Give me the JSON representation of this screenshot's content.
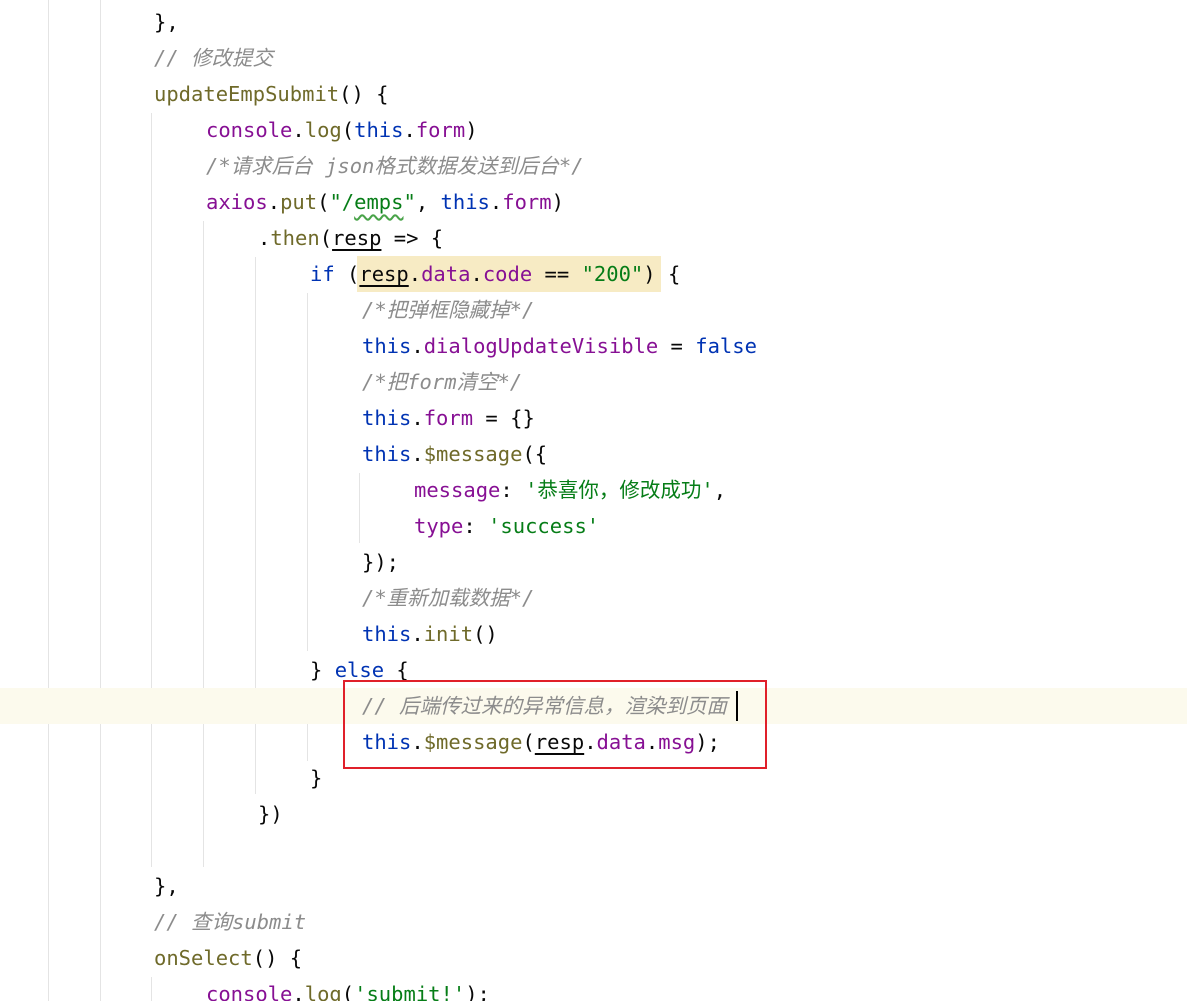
{
  "editor": {
    "lines": [
      [
        {
          "t": "},",
          "c": "plain"
        }
      ],
      [
        {
          "t": "// 修改提交",
          "c": "comment"
        }
      ],
      [
        {
          "t": "updateEmpSubmit",
          "c": "func"
        },
        {
          "t": "() {",
          "c": "plain"
        }
      ],
      [
        {
          "t": "console",
          "c": "prop"
        },
        {
          "t": ".",
          "c": "plain"
        },
        {
          "t": "log",
          "c": "func"
        },
        {
          "t": "(",
          "c": "plain"
        },
        {
          "t": "this",
          "c": "keyword"
        },
        {
          "t": ".",
          "c": "plain"
        },
        {
          "t": "form",
          "c": "prop"
        },
        {
          "t": ")",
          "c": "plain"
        }
      ],
      [
        {
          "t": "/*请求后台 json格式数据发送到后台*/",
          "c": "comment"
        }
      ],
      [
        {
          "t": "axios",
          "c": "prop"
        },
        {
          "t": ".",
          "c": "plain"
        },
        {
          "t": "put",
          "c": "func"
        },
        {
          "t": "(",
          "c": "plain"
        },
        {
          "t": "\"/",
          "c": "string"
        },
        {
          "t": "emps",
          "c": "string",
          "u": "wavy"
        },
        {
          "t": "\"",
          "c": "string"
        },
        {
          "t": ", ",
          "c": "plain"
        },
        {
          "t": "this",
          "c": "keyword"
        },
        {
          "t": ".",
          "c": "plain"
        },
        {
          "t": "form",
          "c": "prop"
        },
        {
          "t": ")",
          "c": "plain"
        }
      ],
      [
        {
          "t": ".",
          "c": "plain"
        },
        {
          "t": "then",
          "c": "func"
        },
        {
          "t": "(",
          "c": "plain"
        },
        {
          "t": "resp",
          "c": "plain",
          "u": "under"
        },
        {
          "t": " => {",
          "c": "plain"
        }
      ],
      [
        {
          "t": "if",
          "c": "keyword"
        },
        {
          "t": " (",
          "c": "plain"
        },
        {
          "t": "resp",
          "c": "plain",
          "u": "under"
        },
        {
          "t": ".",
          "c": "plain"
        },
        {
          "t": "data",
          "c": "prop"
        },
        {
          "t": ".",
          "c": "plain"
        },
        {
          "t": "code",
          "c": "prop"
        },
        {
          "t": " == ",
          "c": "plain"
        },
        {
          "t": "\"200\"",
          "c": "string"
        },
        {
          "t": ") {",
          "c": "plain"
        }
      ],
      [
        {
          "t": "/*把弹框隐藏掉*/",
          "c": "comment"
        }
      ],
      [
        {
          "t": "this",
          "c": "keyword"
        },
        {
          "t": ".",
          "c": "plain"
        },
        {
          "t": "dialogUpdateVisible",
          "c": "prop"
        },
        {
          "t": " = ",
          "c": "plain"
        },
        {
          "t": "false",
          "c": "keyword"
        }
      ],
      [
        {
          "t": "/*把form清空*/",
          "c": "comment"
        }
      ],
      [
        {
          "t": "this",
          "c": "keyword"
        },
        {
          "t": ".",
          "c": "plain"
        },
        {
          "t": "form",
          "c": "prop"
        },
        {
          "t": " = {}",
          "c": "plain"
        }
      ],
      [
        {
          "t": "this",
          "c": "keyword"
        },
        {
          "t": ".",
          "c": "plain"
        },
        {
          "t": "$message",
          "c": "func"
        },
        {
          "t": "({",
          "c": "plain"
        }
      ],
      [
        {
          "t": "message",
          "c": "prop"
        },
        {
          "t": ": ",
          "c": "plain"
        },
        {
          "t": "'恭喜你，修改成功'",
          "c": "string"
        },
        {
          "t": ",",
          "c": "plain"
        }
      ],
      [
        {
          "t": "type",
          "c": "prop"
        },
        {
          "t": ": ",
          "c": "plain"
        },
        {
          "t": "'success'",
          "c": "string"
        }
      ],
      [
        {
          "t": "});",
          "c": "plain"
        }
      ],
      [
        {
          "t": "/*重新加载数据*/",
          "c": "comment"
        }
      ],
      [
        {
          "t": "this",
          "c": "keyword"
        },
        {
          "t": ".",
          "c": "plain"
        },
        {
          "t": "init",
          "c": "func"
        },
        {
          "t": "()",
          "c": "plain"
        }
      ],
      [
        {
          "t": "} ",
          "c": "plain"
        },
        {
          "t": "else",
          "c": "keyword"
        },
        {
          "t": " {",
          "c": "plain"
        }
      ],
      [
        {
          "t": "// 后端传过来的异常信息，渲染到页面",
          "c": "comment"
        }
      ],
      [
        {
          "t": "this",
          "c": "keyword"
        },
        {
          "t": ".",
          "c": "plain"
        },
        {
          "t": "$message",
          "c": "func"
        },
        {
          "t": "(",
          "c": "plain"
        },
        {
          "t": "resp",
          "c": "plain",
          "u": "under"
        },
        {
          "t": ".",
          "c": "plain"
        },
        {
          "t": "data",
          "c": "prop"
        },
        {
          "t": ".",
          "c": "plain"
        },
        {
          "t": "msg",
          "c": "prop"
        },
        {
          "t": ");",
          "c": "plain"
        }
      ],
      [
        {
          "t": "}",
          "c": "plain"
        }
      ],
      [
        {
          "t": "})",
          "c": "plain"
        }
      ],
      [],
      [
        {
          "t": "},",
          "c": "plain"
        }
      ],
      [
        {
          "t": "// 查询submit",
          "c": "comment"
        }
      ],
      [
        {
          "t": "onSelect",
          "c": "func"
        },
        {
          "t": "() {",
          "c": "plain"
        }
      ],
      [
        {
          "t": "console",
          "c": "prop"
        },
        {
          "t": ".",
          "c": "plain"
        },
        {
          "t": "log",
          "c": "func"
        },
        {
          "t": "(",
          "c": "plain"
        },
        {
          "t": "'submit!'",
          "c": "string"
        },
        {
          "t": ");",
          "c": "plain"
        }
      ]
    ]
  },
  "colors": {
    "keyword": "#0033b3",
    "property": "#871094",
    "function": "#6f6a2a",
    "string": "#067d17",
    "comment": "#8c8c8c",
    "current_line": "#fcfaed",
    "usage_highlight": "#f7ebc4",
    "annotation_box": "#e0202a"
  }
}
